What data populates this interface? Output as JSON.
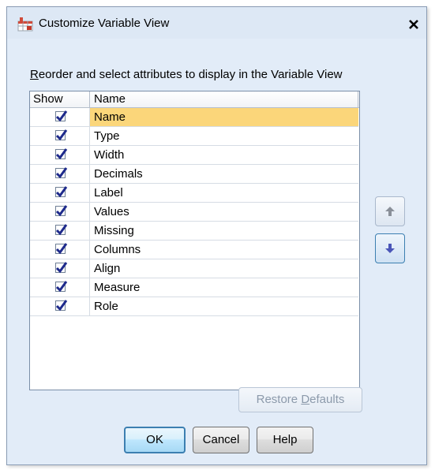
{
  "window": {
    "title": "Customize Variable View",
    "close_glyph": "✕"
  },
  "instruction": {
    "mnemonic": "R",
    "rest": "eorder and select attributes to display in the Variable View"
  },
  "table": {
    "headers": {
      "show": "Show",
      "name": "Name"
    },
    "rows": [
      {
        "name": "Name",
        "checked": true,
        "selected": true
      },
      {
        "name": "Type",
        "checked": true,
        "selected": false
      },
      {
        "name": "Width",
        "checked": true,
        "selected": false
      },
      {
        "name": "Decimals",
        "checked": true,
        "selected": false
      },
      {
        "name": "Label",
        "checked": true,
        "selected": false
      },
      {
        "name": "Values",
        "checked": true,
        "selected": false
      },
      {
        "name": "Missing",
        "checked": true,
        "selected": false
      },
      {
        "name": "Columns",
        "checked": true,
        "selected": false
      },
      {
        "name": "Align",
        "checked": true,
        "selected": false
      },
      {
        "name": "Measure",
        "checked": true,
        "selected": false
      },
      {
        "name": "Role",
        "checked": true,
        "selected": false
      }
    ]
  },
  "side_buttons": {
    "up_icon": "arrow-up-icon",
    "down_icon": "arrow-down-icon"
  },
  "restore": {
    "prefix": "Restore ",
    "mnemonic": "D",
    "suffix": "efaults",
    "enabled": false
  },
  "buttons": {
    "ok": "OK",
    "cancel": "Cancel",
    "help": "Help"
  },
  "colors": {
    "selection": "#fbd67a",
    "check": "#1e2a8c",
    "dialog_bg": "#e2ecf8",
    "focus_border": "#3c7fb1"
  }
}
